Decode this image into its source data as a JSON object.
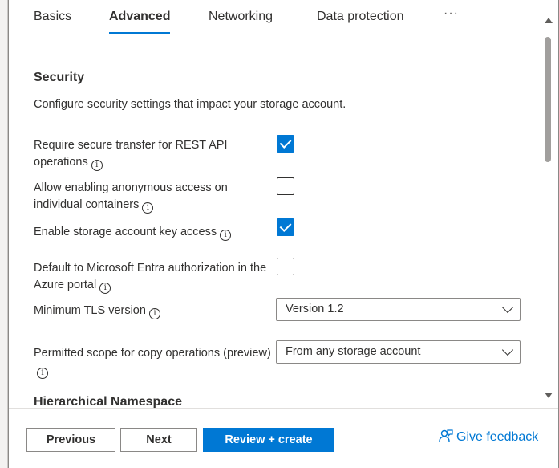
{
  "tabs": {
    "basics": "Basics",
    "advanced": "Advanced",
    "networking": "Networking",
    "data_protection": "Data protection",
    "more": "···"
  },
  "security": {
    "title": "Security",
    "description": "Configure security settings that impact your storage account.",
    "rows": [
      {
        "label": "Require secure transfer for REST API operations",
        "checked": true
      },
      {
        "label": "Allow enabling anonymous access on individual containers",
        "checked": false
      },
      {
        "label": "Enable storage account key access",
        "checked": true
      },
      {
        "label": "Default to Microsoft Entra authorization in the Azure portal",
        "checked": false
      }
    ],
    "tls": {
      "label": "Minimum TLS version",
      "value": "Version 1.2"
    },
    "copy_scope": {
      "label": "Permitted scope for copy operations (preview)",
      "value": "From any storage account"
    }
  },
  "hierarchical": {
    "title": "Hierarchical Namespace"
  },
  "footer": {
    "previous": "Previous",
    "next": "Next",
    "review": "Review + create",
    "feedback": "Give feedback"
  },
  "info_glyph": "i",
  "colors": {
    "accent": "#0078d4",
    "text": "#323130"
  }
}
